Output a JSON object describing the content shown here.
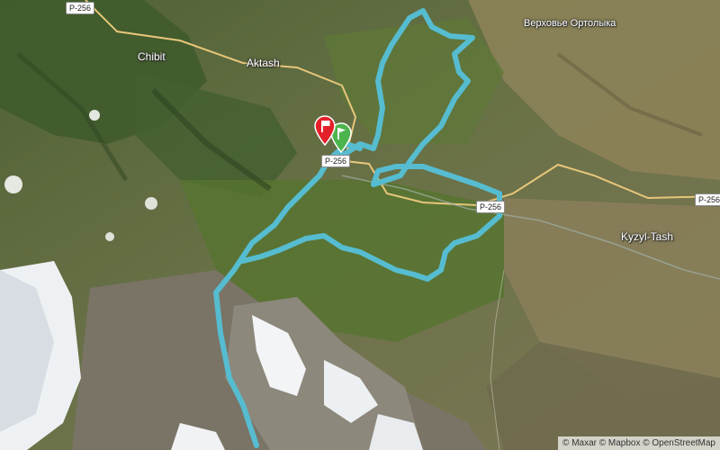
{
  "map": {
    "places": {
      "chibit": "Chibit",
      "aktash": "Aktash",
      "verkhovye": "Верховье Ортолыка",
      "kyzyl_tash": "Kyzyl-Tash"
    },
    "road_shields": {
      "top_left": "P-256",
      "center": "P-256",
      "right_middle": "P-256",
      "far_right": "P-256"
    },
    "markers": {
      "finish": "finish-flag-icon",
      "start": "start-flag-icon"
    },
    "colors": {
      "route": "#56bcd0",
      "road": "#e6c67a",
      "finish_marker": "#e3202a",
      "start_marker": "#4cb44c"
    },
    "attribution": "© Maxar © Mapbox © OpenStreetMap"
  }
}
